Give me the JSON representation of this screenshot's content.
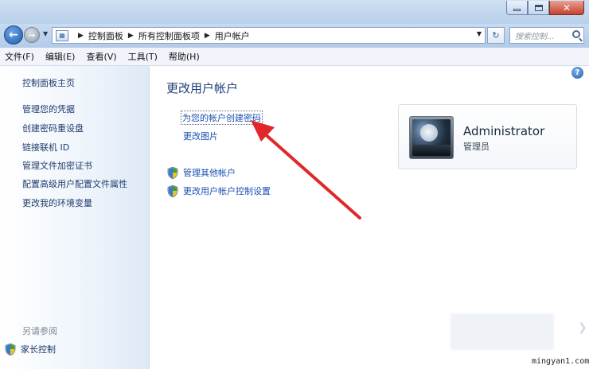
{
  "window": {
    "controls": {
      "minimize": "minimize-icon",
      "maximize": "maximize-icon",
      "close": "close-icon"
    }
  },
  "nav": {
    "breadcrumb": [
      "控制面板",
      "所有控制面板项",
      "用户帐户"
    ],
    "search_placeholder": "搜索控制...",
    "back_icon": "back-arrow-icon",
    "forward_icon": "forward-arrow-icon"
  },
  "menu": [
    "文件(F)",
    "编辑(E)",
    "查看(V)",
    "工具(T)",
    "帮助(H)"
  ],
  "sidebar": {
    "items": [
      {
        "label": "控制面板主页"
      },
      {
        "label": "管理您的凭据"
      },
      {
        "label": "创建密码重设盘"
      },
      {
        "label": "链接联机 ID"
      },
      {
        "label": "管理文件加密证书"
      },
      {
        "label": "配置高级用户配置文件属性"
      },
      {
        "label": "更改我的环境变量"
      }
    ],
    "see_also_title": "另请参阅",
    "parental_controls": "家长控制"
  },
  "main": {
    "title": "更改用户帐户",
    "links": {
      "create_password": "为您的帐户创建密码",
      "change_picture": "更改图片"
    },
    "tasks": {
      "manage_other": "管理其他帐户",
      "uac_settings": "更改用户帐户控制设置"
    }
  },
  "account": {
    "name": "Administrator",
    "role": "管理员"
  },
  "colors": {
    "link": "#1a4fb0",
    "title": "#1e3f78",
    "annotation_arrow": "#e0282a"
  },
  "watermark": "mingyan1.com"
}
